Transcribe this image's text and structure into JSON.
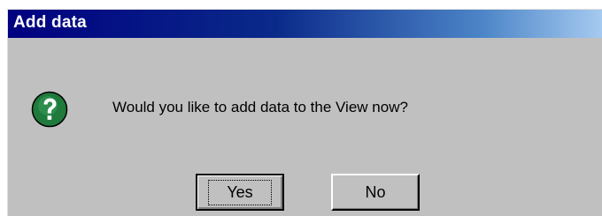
{
  "window": {
    "title": "Add data"
  },
  "dialog": {
    "icon": "question-icon",
    "message": "Would you like to add data to the View now?"
  },
  "buttons": {
    "yes_label": "Yes",
    "no_label": "No"
  },
  "colors": {
    "title_bar_start": "#000080",
    "title_bar_end": "#a6caf0",
    "dialog_background": "#c0c0c0",
    "icon_green": "#1f7a3c"
  }
}
